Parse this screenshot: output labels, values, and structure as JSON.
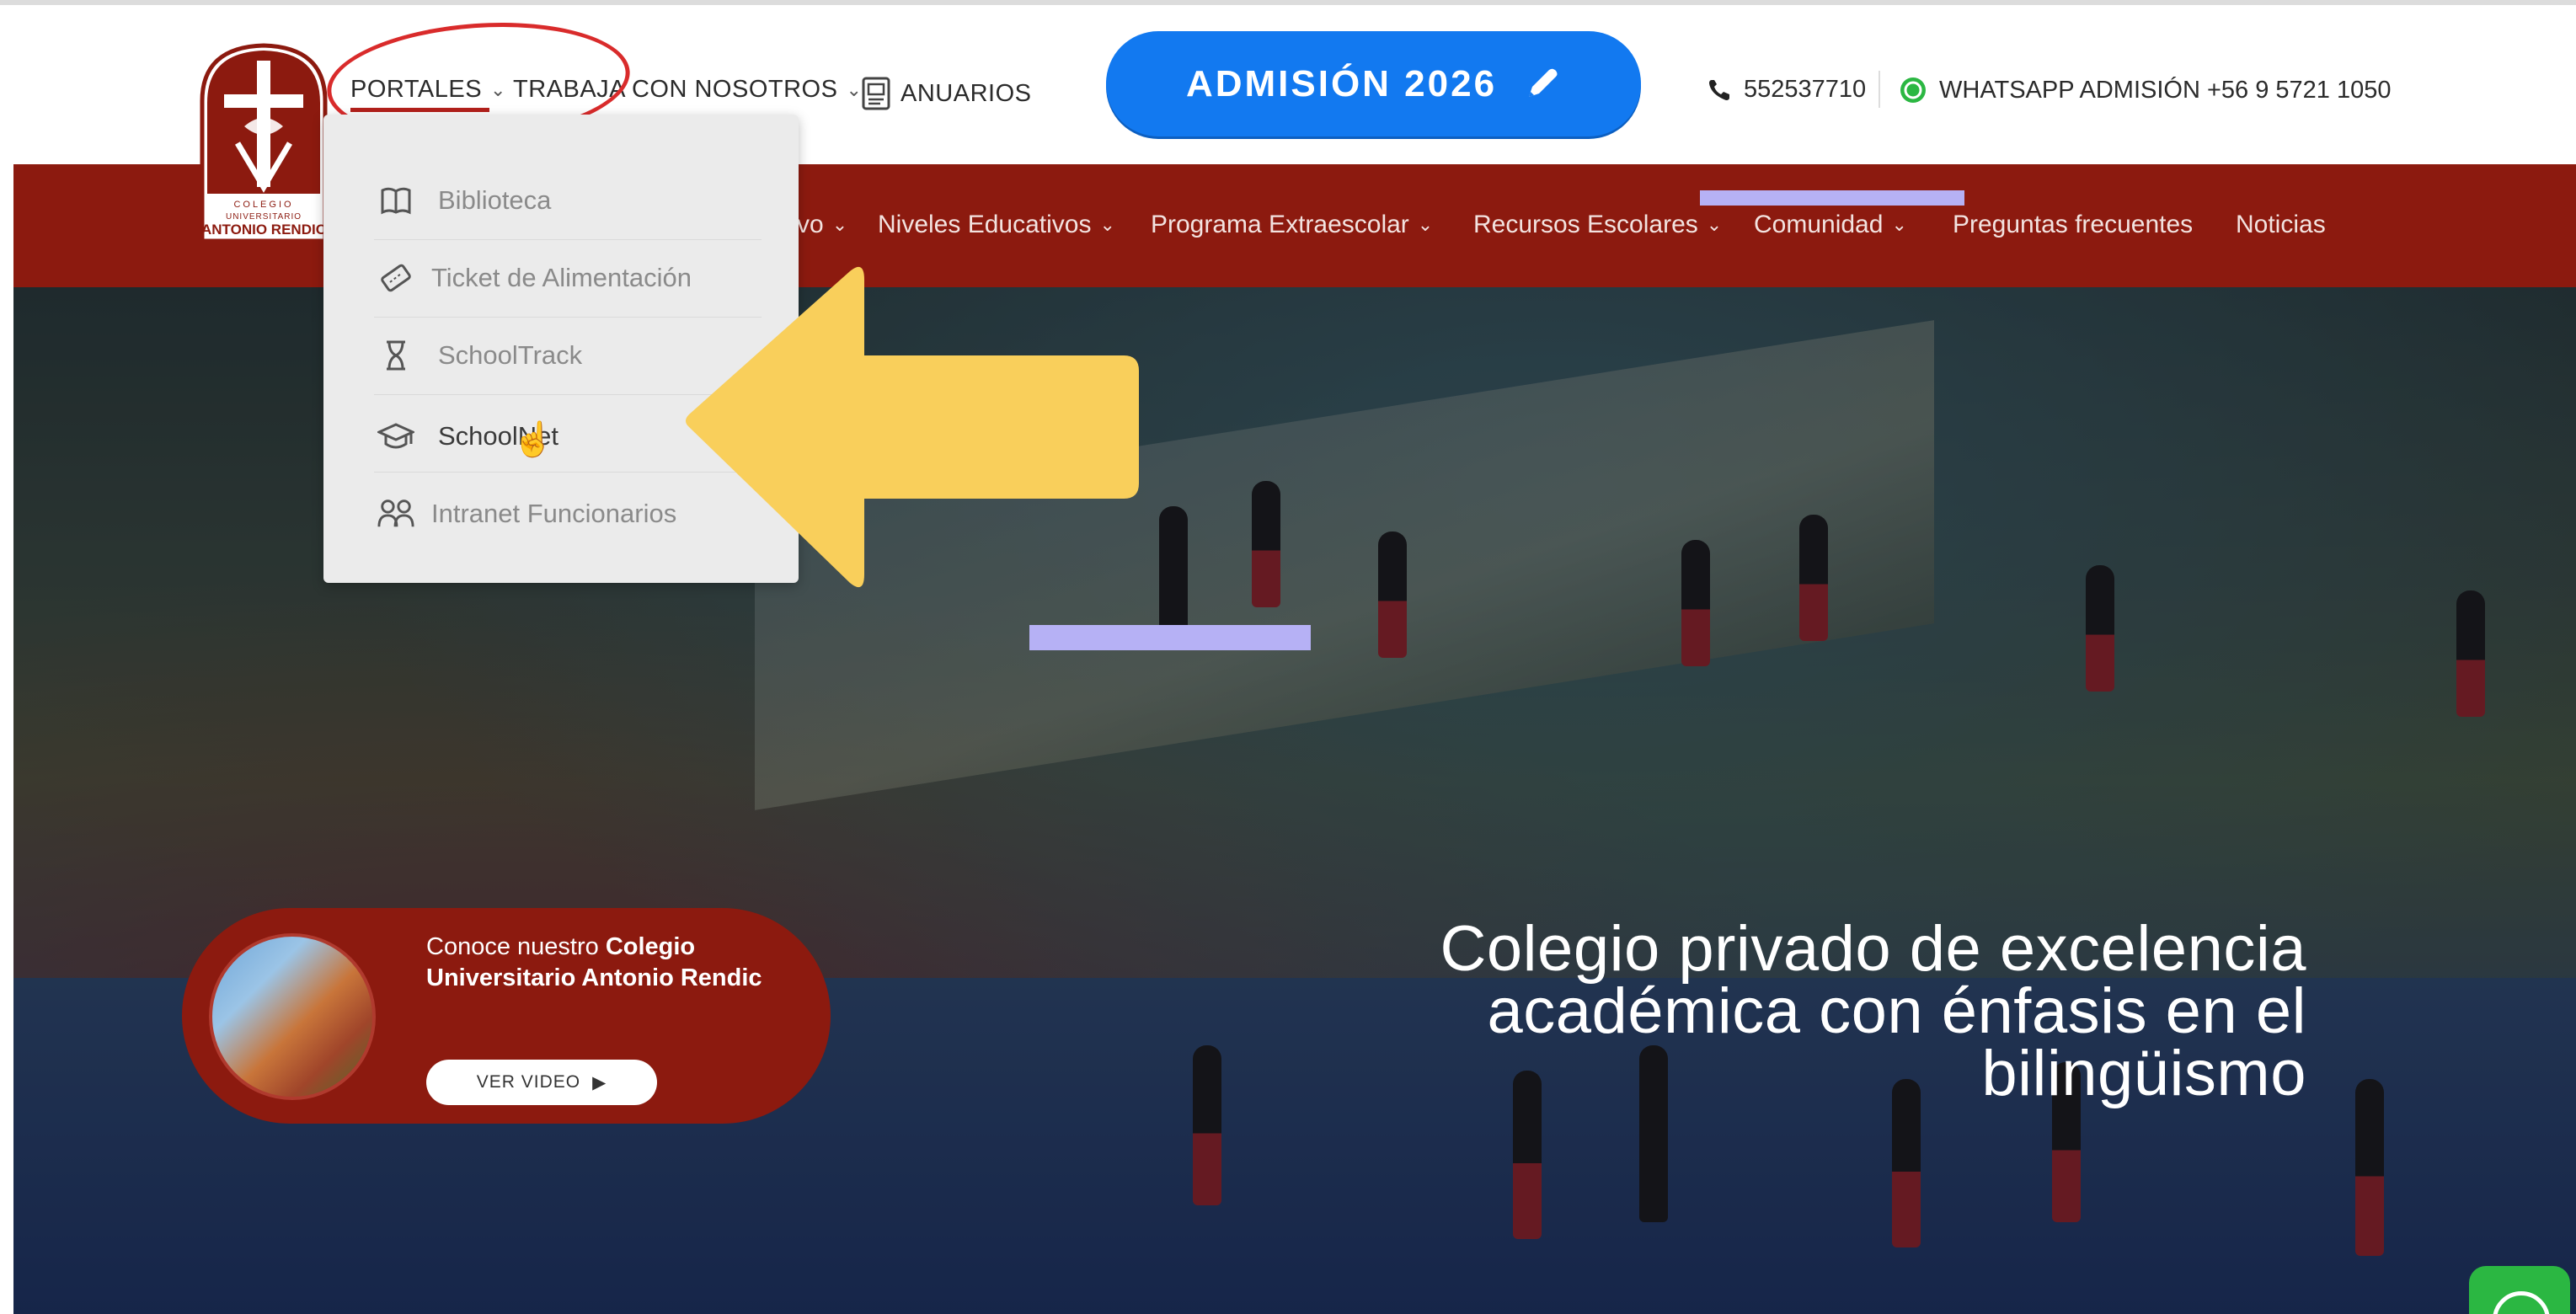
{
  "header": {
    "logo_text": "COLEGIO UNIVERSITARIO ANTONIO RENDIC",
    "nav_top": {
      "portales": "PORTALES",
      "trabaja": "TRABAJA CON NOSOTROS",
      "anuarios": "ANUARIOS"
    },
    "admission_button": "ADMISIÓN 2026",
    "phone": "552537710",
    "whatsapp": "WHATSAPP ADMISIÓN +56 9 5721 1050"
  },
  "main_nav": {
    "items": [
      "vo",
      "Niveles Educativos",
      "Programa Extraescolar",
      "Recursos Escolares",
      "Comunidad",
      "Preguntas frecuentes",
      "Noticias"
    ]
  },
  "dropdown": {
    "items": [
      {
        "label": "Biblioteca",
        "icon": "book-icon"
      },
      {
        "label": "Ticket de Alimentación",
        "icon": "ticket-icon"
      },
      {
        "label": "SchoolTrack",
        "icon": "hourglass-icon"
      },
      {
        "label": "SchoolNet",
        "icon": "graduation-cap-icon"
      },
      {
        "label": "Intranet Funcionarios",
        "icon": "users-icon"
      }
    ],
    "hovered": "SchoolNet"
  },
  "hero": {
    "title_lines": [
      "Colegio privado de excelencia",
      "académica con énfasis en el",
      "bilingüismo"
    ],
    "promo": {
      "prefix": "Conoce nuestro ",
      "bold": "Colegio Universitario Antonio Rendic",
      "button": "VER VIDEO"
    }
  },
  "colors": {
    "brand_red": "#8c1a0f",
    "admission_blue": "#1279f0",
    "annotation_yellow": "#f9cf5b",
    "annotation_ellipse": "#d92b2b",
    "whatsapp_green": "#2bb742"
  }
}
